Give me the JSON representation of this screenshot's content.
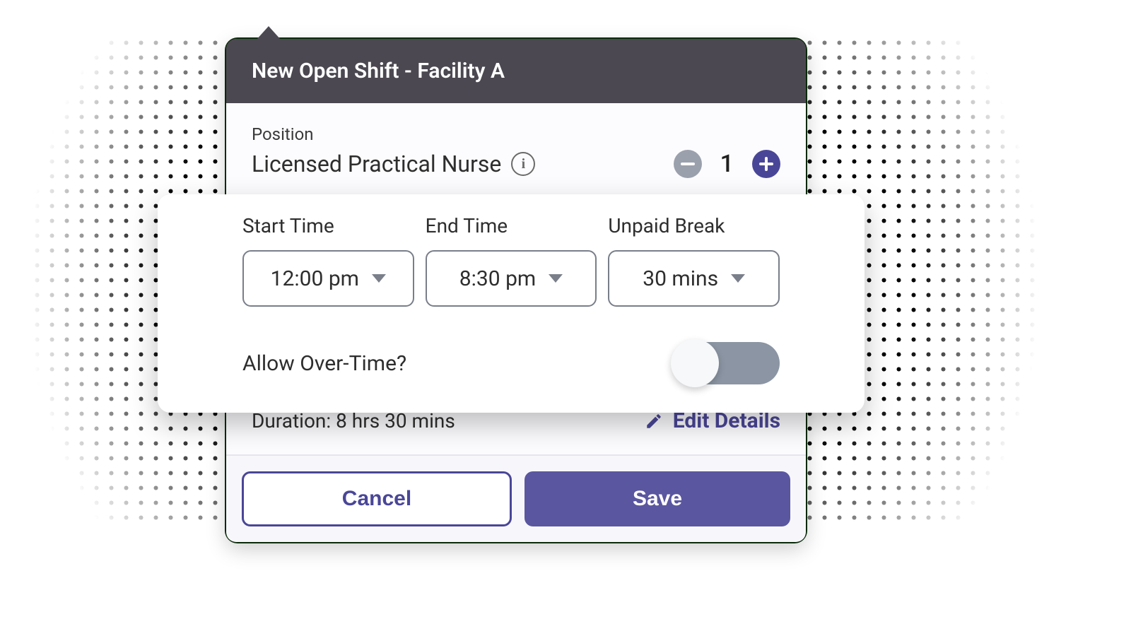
{
  "header": {
    "title": "New Open Shift - Facility A"
  },
  "position": {
    "label": "Position",
    "name": "Licensed Practical Nurse",
    "count": "1"
  },
  "time": {
    "start": {
      "label": "Start Time",
      "value": "12:00 pm"
    },
    "end": {
      "label": "End Time",
      "value": "8:30 pm"
    },
    "break": {
      "label": "Unpaid Break",
      "value": "30 mins"
    }
  },
  "overtime": {
    "label": "Allow Over-Time?",
    "enabled": false
  },
  "duration": {
    "prefix": "Duration: ",
    "value": "8 hrs 30 mins",
    "edit_label": "Edit Details"
  },
  "footer": {
    "cancel": "Cancel",
    "save": "Save"
  },
  "colors": {
    "accent": "#4a4697",
    "header": "#4c4851",
    "muted": "#9aa0ac"
  }
}
